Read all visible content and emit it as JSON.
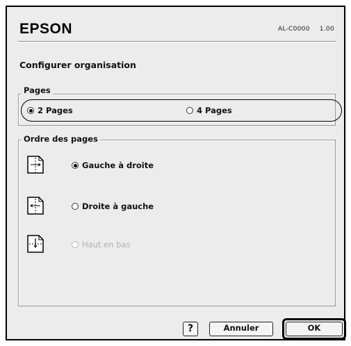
{
  "brand": "EPSON",
  "model": {
    "name": "AL-C0000",
    "version": "1.00"
  },
  "heading": "Configurer organisation",
  "pages_group": {
    "label": "Pages",
    "options": [
      {
        "label": "2 Pages",
        "selected": true
      },
      {
        "label": "4 Pages",
        "selected": false
      }
    ]
  },
  "order_group": {
    "label": "Ordre des pages",
    "options": [
      {
        "label": "Gauche à droite",
        "selected": true,
        "enabled": true,
        "icon": "left-to-right-page-icon"
      },
      {
        "label": "Droite à gauche",
        "selected": false,
        "enabled": true,
        "icon": "right-to-left-page-icon"
      },
      {
        "label": "Haut en bas",
        "selected": false,
        "enabled": false,
        "icon": "top-to-bottom-page-icon"
      }
    ]
  },
  "buttons": {
    "help": "?",
    "cancel": "Annuler",
    "ok": "OK"
  }
}
